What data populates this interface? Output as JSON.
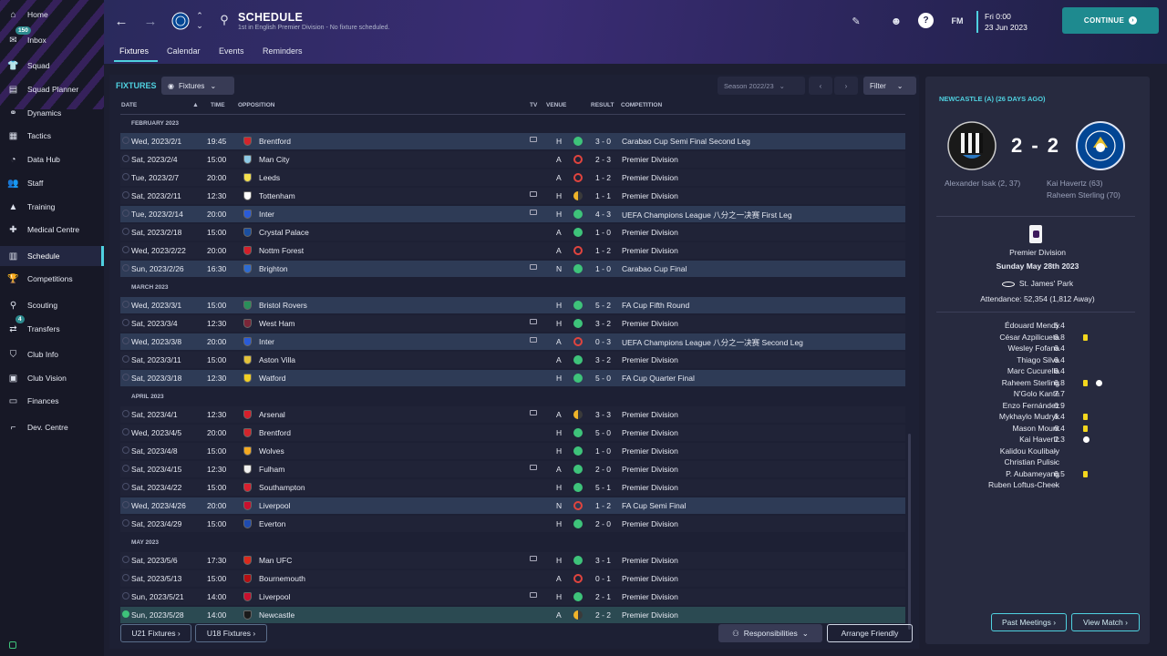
{
  "sidebar": {
    "items": [
      {
        "label": "Home",
        "icon": "home-icon",
        "glyph": "⌂"
      },
      {
        "label": "Inbox",
        "icon": "inbox-icon",
        "glyph": "✉",
        "badge": "150"
      },
      {
        "label": "Squad",
        "icon": "shirt-icon",
        "glyph": "👕"
      },
      {
        "label": "Squad Planner",
        "icon": "clipboard-icon",
        "glyph": "▤"
      },
      {
        "label": "Dynamics",
        "icon": "handshake-icon",
        "glyph": "⚭"
      },
      {
        "label": "Tactics",
        "icon": "tactics-board-icon",
        "glyph": "▦"
      },
      {
        "label": "Data Hub",
        "icon": "pie-chart-icon",
        "glyph": "◔"
      },
      {
        "label": "Staff",
        "icon": "people-icon",
        "glyph": "👥"
      },
      {
        "label": "Training",
        "icon": "cone-icon",
        "glyph": "▲"
      },
      {
        "label": "Medical Centre",
        "icon": "medical-kit-icon",
        "glyph": "✚"
      },
      {
        "label": "Schedule",
        "icon": "calendar-icon",
        "glyph": "▥",
        "active": true
      },
      {
        "label": "Competitions",
        "icon": "trophy-icon",
        "glyph": "🏆"
      },
      {
        "label": "Scouting",
        "icon": "magnifier-icon",
        "glyph": "⚲"
      },
      {
        "label": "Transfers",
        "icon": "transfer-icon",
        "glyph": "⇄",
        "badge": "4"
      },
      {
        "label": "Club Info",
        "icon": "shield-icon",
        "glyph": "⛉"
      },
      {
        "label": "Club Vision",
        "icon": "building-icon",
        "glyph": "▣"
      },
      {
        "label": "Finances",
        "icon": "cash-icon",
        "glyph": "▭"
      },
      {
        "label": "Dev. Centre",
        "icon": "boot-icon",
        "glyph": "⌐"
      }
    ]
  },
  "header": {
    "title": "SCHEDULE",
    "subtitle": "1st in English Premier Division - No fixture scheduled.",
    "tabs": [
      "Fixtures",
      "Calendar",
      "Events",
      "Reminders"
    ],
    "fm_label": "FM",
    "date_line1": "Fri 0:00",
    "date_line2": "23 Jun 2023",
    "continue_label": "CONTINUE"
  },
  "fixtures": {
    "title": "FIXTURES",
    "view_dropdown": "Fixtures",
    "season": "Season 2022/23",
    "filter": "Filter",
    "columns": {
      "date": "DATE",
      "time": "TIME",
      "opposition": "OPPOSITION",
      "tv": "TV",
      "venue": "VENUE",
      "result": "RESULT",
      "competition": "COMPETITION"
    },
    "rows": [
      {
        "section": "FEBRUARY 2023"
      },
      {
        "date": "Wed, 2023/2/1",
        "time": "19:45",
        "opp": "Brentford",
        "tv": true,
        "venue": "H",
        "res": "win",
        "score": "3 - 0",
        "comp": "Carabao Cup Semi Final Second Leg",
        "hl": "hi",
        "crest": "#d2252c"
      },
      {
        "date": "Sat, 2023/2/4",
        "time": "15:00",
        "opp": "Man City",
        "tv": false,
        "venue": "A",
        "res": "loss",
        "score": "2 - 3",
        "comp": "Premier Division",
        "crest": "#8ecae6"
      },
      {
        "date": "Tue, 2023/2/7",
        "time": "20:00",
        "opp": "Leeds",
        "tv": false,
        "venue": "A",
        "res": "loss",
        "score": "1 - 2",
        "comp": "Premier Division",
        "crest": "#f4e04d"
      },
      {
        "date": "Sat, 2023/2/11",
        "time": "12:30",
        "opp": "Tottenham",
        "tv": true,
        "venue": "H",
        "res": "draw",
        "score": "1 - 1",
        "comp": "Premier Division",
        "crest": "#ffffff"
      },
      {
        "date": "Tue, 2023/2/14",
        "time": "20:00",
        "opp": "Inter",
        "tv": true,
        "venue": "H",
        "res": "win",
        "score": "4 - 3",
        "comp": "UEFA Champions League 八分之一决赛 First Leg",
        "hl": "hi",
        "crest": "#2a5bd7"
      },
      {
        "date": "Sat, 2023/2/18",
        "time": "15:00",
        "opp": "Crystal Palace",
        "tv": false,
        "venue": "A",
        "res": "win",
        "score": "1 - 0",
        "comp": "Premier Division",
        "crest": "#1b4fa0"
      },
      {
        "date": "Wed, 2023/2/22",
        "time": "20:00",
        "opp": "Nottm Forest",
        "tv": false,
        "venue": "A",
        "res": "loss",
        "score": "1 - 2",
        "comp": "Premier Division",
        "crest": "#d21f2a"
      },
      {
        "date": "Sun, 2023/2/26",
        "time": "16:30",
        "opp": "Brighton",
        "tv": true,
        "venue": "N",
        "res": "win",
        "score": "1 - 0",
        "comp": "Carabao Cup Final",
        "hl": "hi",
        "crest": "#2e6bd1"
      },
      {
        "section": "MARCH 2023"
      },
      {
        "date": "Wed, 2023/3/1",
        "time": "15:00",
        "opp": "Bristol Rovers",
        "tv": false,
        "venue": "H",
        "res": "win",
        "score": "5 - 2",
        "comp": "FA Cup Fifth Round",
        "hl": "hi",
        "crest": "#2a8f5a"
      },
      {
        "date": "Sat, 2023/3/4",
        "time": "12:30",
        "opp": "West Ham",
        "tv": true,
        "venue": "H",
        "res": "win",
        "score": "3 - 2",
        "comp": "Premier Division",
        "crest": "#7a2638"
      },
      {
        "date": "Wed, 2023/3/8",
        "time": "20:00",
        "opp": "Inter",
        "tv": true,
        "venue": "A",
        "res": "loss",
        "score": "0 - 3",
        "comp": "UEFA Champions League 八分之一决赛 Second Leg",
        "hl": "hi",
        "crest": "#2a5bd7"
      },
      {
        "date": "Sat, 2023/3/11",
        "time": "15:00",
        "opp": "Aston Villa",
        "tv": false,
        "venue": "A",
        "res": "win",
        "score": "3 - 2",
        "comp": "Premier Division",
        "crest": "#e3c23a"
      },
      {
        "date": "Sat, 2023/3/18",
        "time": "12:30",
        "opp": "Watford",
        "tv": false,
        "venue": "H",
        "res": "win",
        "score": "5 - 0",
        "comp": "FA Cup Quarter Final",
        "hl": "hi",
        "crest": "#f1cf24"
      },
      {
        "section": "APRIL 2023"
      },
      {
        "date": "Sat, 2023/4/1",
        "time": "12:30",
        "opp": "Arsenal",
        "tv": true,
        "venue": "A",
        "res": "draw",
        "score": "3 - 3",
        "comp": "Premier Division",
        "crest": "#d61f2b"
      },
      {
        "date": "Wed, 2023/4/5",
        "time": "20:00",
        "opp": "Brentford",
        "tv": false,
        "venue": "H",
        "res": "win",
        "score": "5 - 0",
        "comp": "Premier Division",
        "crest": "#d2252c"
      },
      {
        "date": "Sat, 2023/4/8",
        "time": "15:00",
        "opp": "Wolves",
        "tv": false,
        "venue": "H",
        "res": "win",
        "score": "1 - 0",
        "comp": "Premier Division",
        "crest": "#f4a921"
      },
      {
        "date": "Sat, 2023/4/15",
        "time": "12:30",
        "opp": "Fulham",
        "tv": true,
        "venue": "A",
        "res": "win",
        "score": "2 - 0",
        "comp": "Premier Division",
        "crest": "#f1f1f1"
      },
      {
        "date": "Sat, 2023/4/22",
        "time": "15:00",
        "opp": "Southampton",
        "tv": false,
        "venue": "H",
        "res": "win",
        "score": "5 - 1",
        "comp": "Premier Division",
        "crest": "#d8202f"
      },
      {
        "date": "Wed, 2023/4/26",
        "time": "20:00",
        "opp": "Liverpool",
        "tv": false,
        "venue": "N",
        "res": "loss",
        "score": "1 - 2",
        "comp": "FA Cup Semi Final",
        "hl": "hi",
        "crest": "#c8102e"
      },
      {
        "date": "Sat, 2023/4/29",
        "time": "15:00",
        "opp": "Everton",
        "tv": false,
        "venue": "H",
        "res": "win",
        "score": "2 - 0",
        "comp": "Premier Division",
        "crest": "#1f4bb0"
      },
      {
        "section": "MAY 2023"
      },
      {
        "date": "Sat, 2023/5/6",
        "time": "17:30",
        "opp": "Man UFC",
        "tv": true,
        "venue": "H",
        "res": "win",
        "score": "3 - 1",
        "comp": "Premier Division",
        "crest": "#da291c"
      },
      {
        "date": "Sat, 2023/5/13",
        "time": "15:00",
        "opp": "Bournemouth",
        "tv": false,
        "venue": "A",
        "res": "loss",
        "score": "0 - 1",
        "comp": "Premier Division",
        "crest": "#b50e12"
      },
      {
        "date": "Sun, 2023/5/21",
        "time": "14:00",
        "opp": "Liverpool",
        "tv": true,
        "venue": "H",
        "res": "win",
        "score": "2 - 1",
        "comp": "Premier Division",
        "crest": "#c8102e"
      },
      {
        "date": "Sun, 2023/5/28",
        "time": "14:00",
        "opp": "Newcastle",
        "tv": false,
        "venue": "A",
        "res": "draw",
        "score": "2 - 2",
        "comp": "Premier Division",
        "hl": "hl",
        "crest": "#1a1a1a",
        "checked": true
      }
    ],
    "buttons": {
      "u21": "U21 Fixtures ›",
      "u18": "U18 Fixtures ›",
      "responsibilities": "Responsibilities",
      "friendly": "Arrange Friendly"
    }
  },
  "match": {
    "title": "NEWCASTLE (A) (26 DAYS AGO)",
    "score": "2 - 2",
    "home_scorers": "Alexander Isak (2, 37)",
    "away_scorers": [
      "Kai Havertz (63)",
      "Raheem Sterling (70)"
    ],
    "competition": "Premier Division",
    "date": "Sunday May 28th 2023",
    "stadium": "St. James' Park",
    "attendance": "Attendance: 52,354 (1,812 Away)",
    "players": [
      {
        "name": "Édouard Mendy",
        "rating": "6.4"
      },
      {
        "name": "César Azpilicueta",
        "rating": "6.8",
        "yellow": true
      },
      {
        "name": "Wesley Fofana",
        "rating": "6.4"
      },
      {
        "name": "Thiago Silva",
        "rating": "6.4"
      },
      {
        "name": "Marc Cucurella",
        "rating": "6.4"
      },
      {
        "name": "Raheem Sterling",
        "rating": "6.8",
        "yellow": true,
        "goal": true
      },
      {
        "name": "N'Golo Kanté",
        "rating": "7.7"
      },
      {
        "name": "Enzo Fernández",
        "rating": "6.9"
      },
      {
        "name": "Mykhaylo Mudryk",
        "rating": "6.4",
        "yellow": true
      },
      {
        "name": "Mason Mount",
        "rating": "6.4",
        "yellow": true
      },
      {
        "name": "Kai Havertz",
        "rating": "7.3",
        "goal": true
      },
      {
        "name": "Kalidou Koulibaly",
        "rating": "-"
      },
      {
        "name": "Christian Pulisic",
        "rating": "-"
      },
      {
        "name": "P. Aubameyang",
        "rating": "6.5",
        "yellow": true
      },
      {
        "name": "Ruben Loftus-Cheek",
        "rating": "-"
      }
    ],
    "past_meetings": "Past Meetings ›",
    "view_match": "View Match ›"
  },
  "colors": {
    "accent": "#4fd1e0",
    "win": "#3ec37a",
    "loss": "#e0443e",
    "draw": "#f0b429",
    "chelsea": "#034694"
  }
}
